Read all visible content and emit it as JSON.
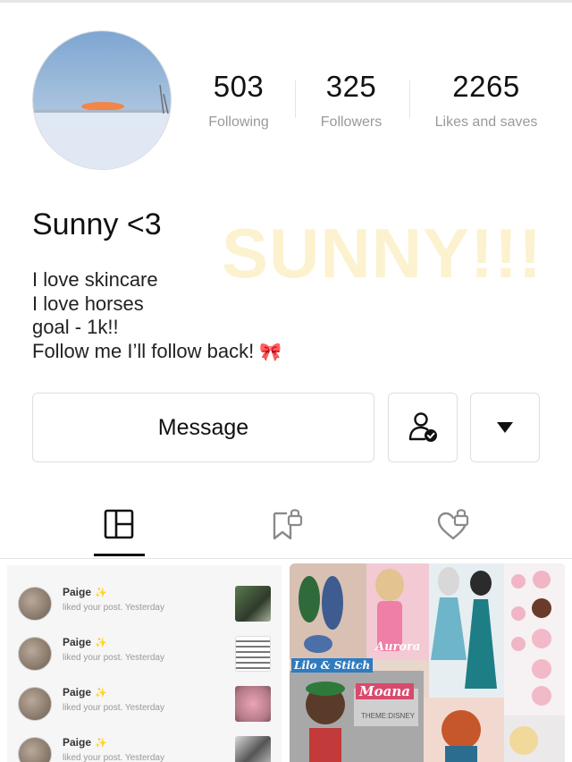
{
  "profile": {
    "username": "Sunny <3",
    "watermark": "SUNNY!!!",
    "bio": [
      "I love skincare",
      "I love horses",
      "goal - 1k!!",
      "Follow me I’ll follow back!"
    ],
    "bio_emoji": "🎀",
    "avatar_icon": "sunset-avatar"
  },
  "stats": [
    {
      "value": "503",
      "label": "Following"
    },
    {
      "value": "325",
      "label": "Followers"
    },
    {
      "value": "2265",
      "label": "Likes and saves"
    }
  ],
  "actions": {
    "message_label": "Message",
    "follow_icon": "person-check-icon",
    "more_icon": "caret-down-icon"
  },
  "tabs": [
    {
      "name": "posts",
      "icon": "grid-icon",
      "active": true
    },
    {
      "name": "saved",
      "icon": "bookmark-lock-icon",
      "active": false
    },
    {
      "name": "liked",
      "icon": "heart-lock-icon",
      "active": false
    }
  ],
  "notifications": [
    {
      "name": "Paige",
      "text": "liked your post. Yesterday"
    },
    {
      "name": "Paige",
      "text": "liked your post. Yesterday"
    },
    {
      "name": "Paige",
      "text": "liked your post. Yesterday"
    },
    {
      "name": "Paige",
      "text": "liked your post. Yesterday"
    }
  ],
  "collage": {
    "labels": [
      "Lilo & Stitch",
      "Aurora",
      "Moana",
      "THEME:DISNEY"
    ]
  },
  "colors": {
    "text": "#111111",
    "muted": "#9a9a9a",
    "border": "#dedede",
    "watermark": "#fbe8a8",
    "bow": "#e0314a"
  }
}
